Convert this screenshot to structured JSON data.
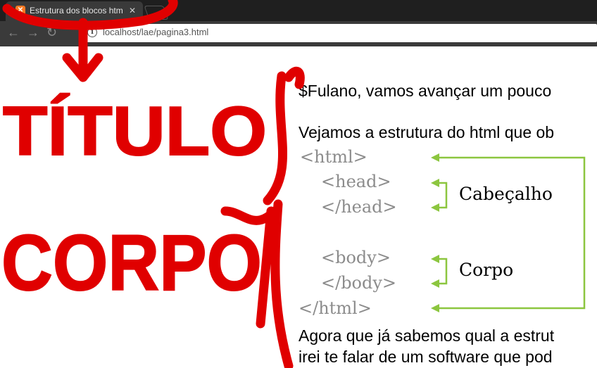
{
  "tab": {
    "title": "Estrutura dos blocos htm",
    "favicon": "xampp-icon"
  },
  "address": {
    "url": "localhost/lae/pagina3.html"
  },
  "page": {
    "line1": "$Fulano, vamos avançar um pouco",
    "line2": "Vejamos a estrutura do html que ob",
    "line3": "Agora que já sabemos qual a estrut",
    "line4": "irei te falar de um software que pod"
  },
  "diagram": {
    "html_open": "<html>",
    "head_open": "<head>",
    "head_close": "</head>",
    "body_open": "<body>",
    "body_close": "</body>",
    "html_close": "</html>",
    "label_head": "Cabeçalho",
    "label_body": "Corpo",
    "arrow_color": "#8cc63f"
  },
  "annotations": {
    "titulo": "TÍTULO",
    "corpo": "CORPO",
    "color": "#e00000"
  }
}
